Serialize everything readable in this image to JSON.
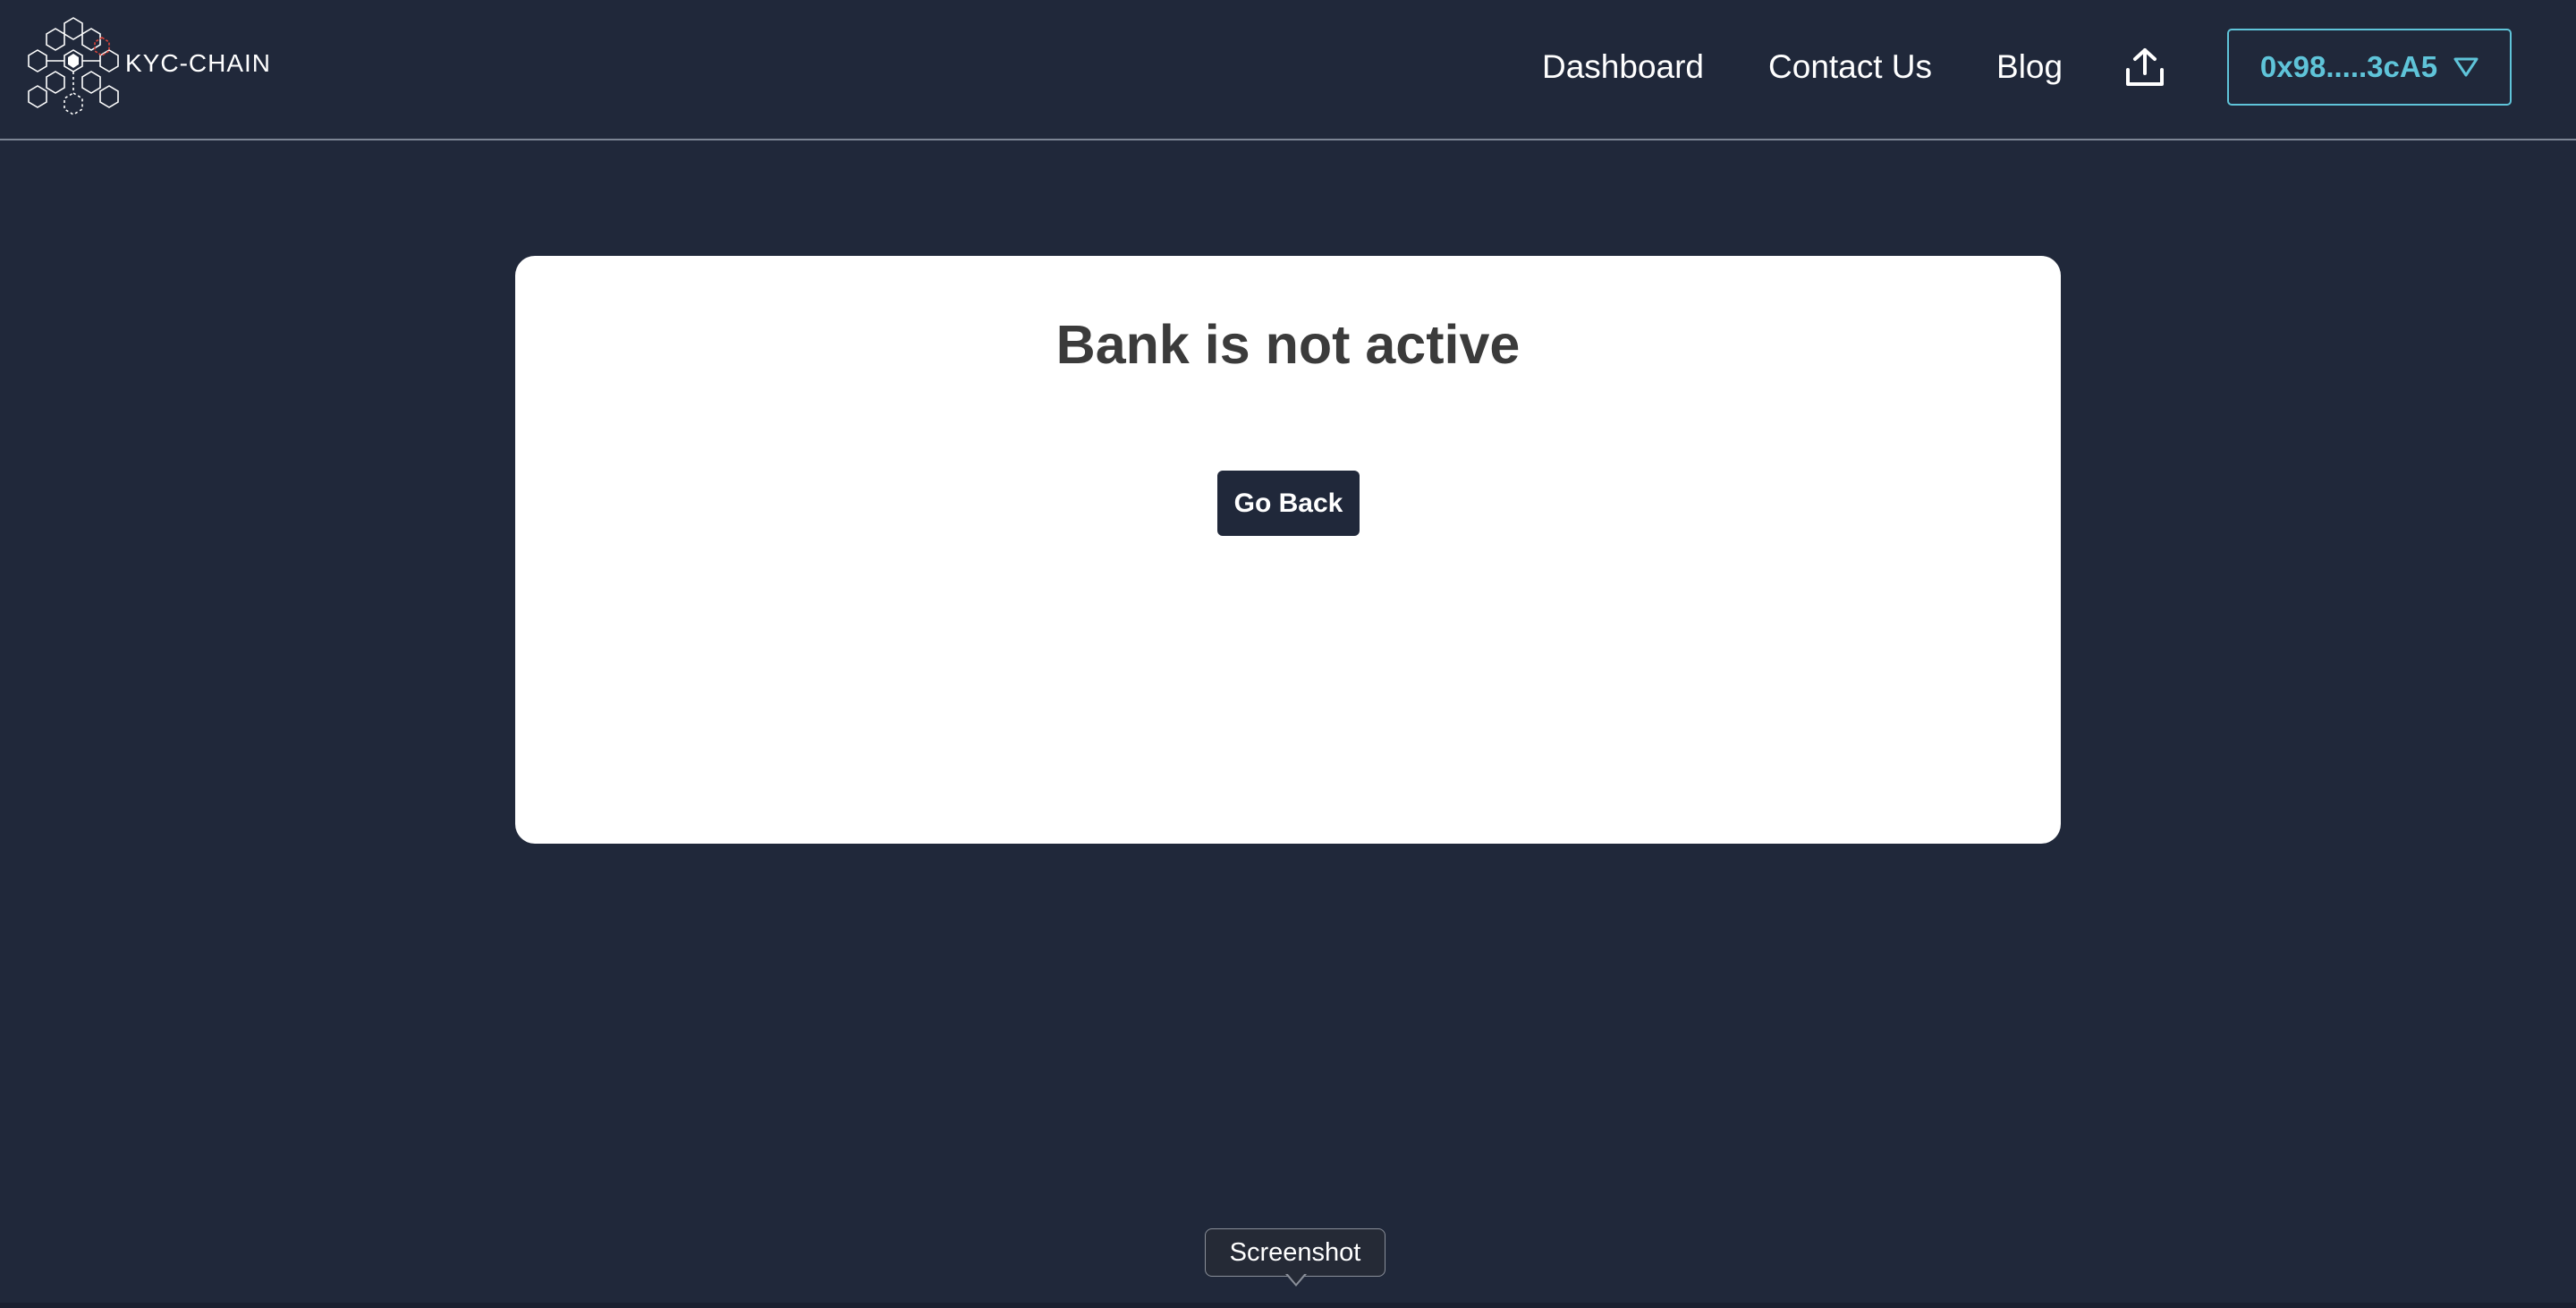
{
  "navbar": {
    "logo_text": "KYC-CHAIN",
    "links": {
      "dashboard": "Dashboard",
      "contact": "Contact Us",
      "blog": "Blog"
    },
    "upload_icon": "upload-icon",
    "wallet_address": "0x98.....3cA5",
    "wallet_caret_icon": "triangle-down-icon"
  },
  "card": {
    "title": "Bank is not active",
    "go_back_label": "Go Back"
  },
  "tooltip": {
    "label": "Screenshot"
  },
  "colors": {
    "background": "#20283a",
    "accent": "#5fc4d9",
    "card": "#ffffff",
    "logo_highlight": "#d9443a"
  }
}
